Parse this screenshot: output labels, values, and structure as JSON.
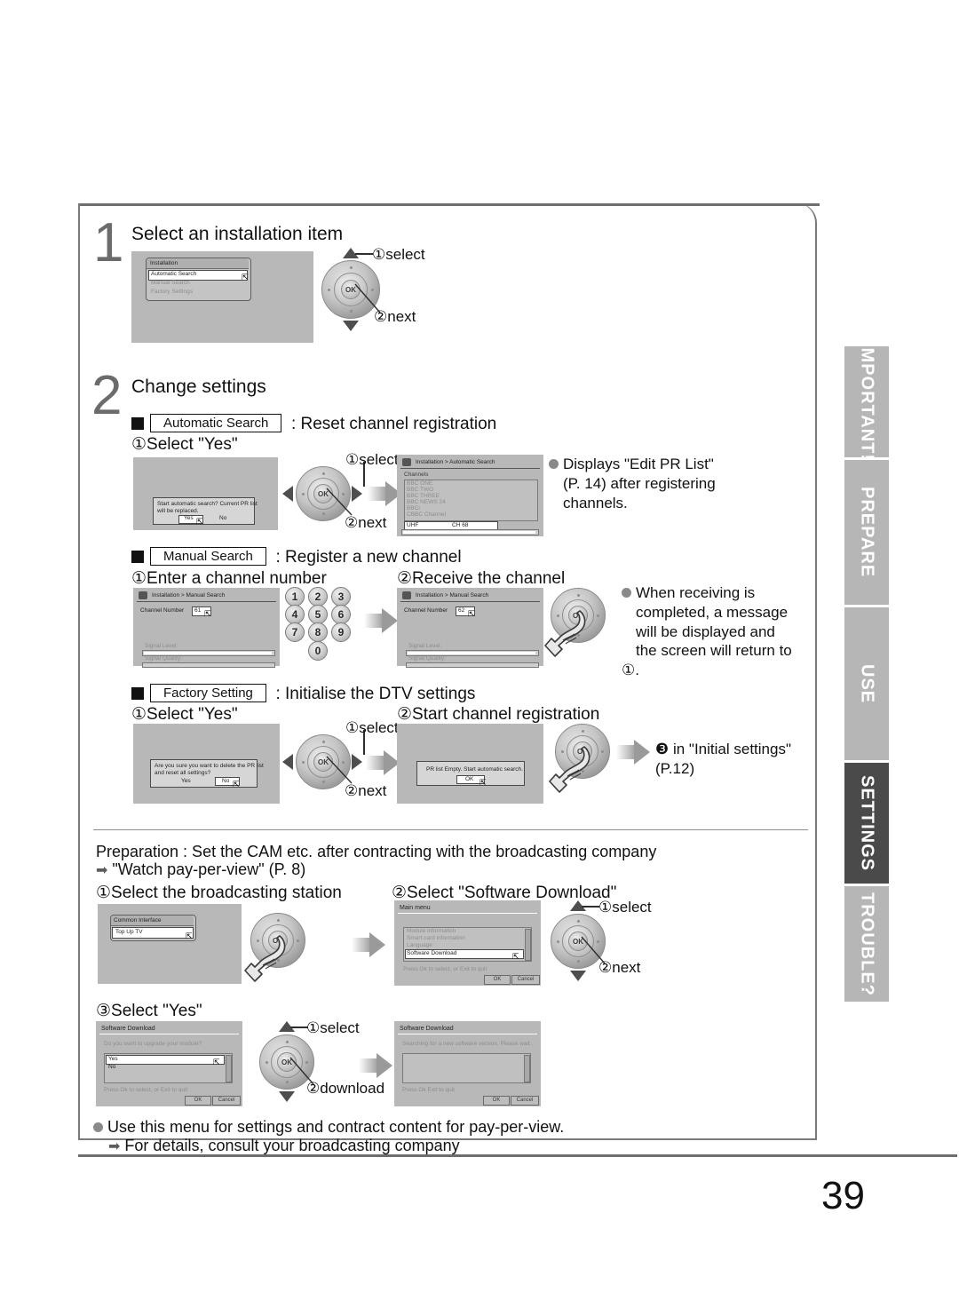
{
  "page": {
    "number": "39"
  },
  "tabs": [
    {
      "label": "IMPORTANT!",
      "active": false
    },
    {
      "label": "PREPARE",
      "active": false
    },
    {
      "label": "USE",
      "active": false
    },
    {
      "label": "SETTINGS",
      "active": true
    },
    {
      "label": "TROUBLE?",
      "active": false
    }
  ],
  "step1": {
    "number": "1",
    "title": "Select an installation item",
    "screen": {
      "menu_title": "Installation",
      "items": [
        "Automatic Search",
        "Manual Search",
        "Factory Settings"
      ],
      "selected": "Automatic Search"
    },
    "ring_labels": {
      "select": "①select",
      "next": "②next"
    }
  },
  "step2": {
    "number": "2",
    "title": "Change settings",
    "auto": {
      "box_label": "Automatic Search",
      "heading_suffix": ": Reset channel registration",
      "substep": "①Select \"Yes\"",
      "dialog": {
        "text_line1": "Start automatic search? Current PR list",
        "text_line2": "will be replaced.",
        "yes": "Yes",
        "no": "No"
      },
      "ring_labels": {
        "select": "①select",
        "next": "②next"
      },
      "result_screen": {
        "title": "Installation > Automatic Search",
        "list_label": "Channels",
        "channels": [
          "BBC ONE",
          "BBC TWO",
          "BBC THREE",
          "BBC NEWS 24",
          "BBCi",
          "CBBC Channel"
        ],
        "band": "UHF",
        "channel": "CH 68",
        "progress": "100%"
      },
      "note_line1": "Displays \"Edit PR List\"",
      "note_line2": "(P. 14) after registering",
      "note_line3": "channels."
    },
    "manual": {
      "box_label": "Manual Search",
      "heading_suffix": ": Register a new channel",
      "substep1": "①Enter a channel number",
      "substep2": "②Receive the channel",
      "screen1": {
        "title": "Installation > Manual Search",
        "field_label": "Channel Number",
        "value": "61",
        "signal_level": "Signal Level:",
        "signal_quality": "Signal Quality:"
      },
      "screen2": {
        "title": "Installation > Manual Search",
        "field_label": "Channel Number",
        "value": "62",
        "signal_level": "Signal Level:",
        "signal_quality": "Signal Quality:"
      },
      "keypad": [
        "1",
        "2",
        "3",
        "4",
        "5",
        "6",
        "7",
        "8",
        "9",
        "0"
      ],
      "note_line1": "When receiving is",
      "note_line2": "completed, a message",
      "note_line3": "will be displayed and",
      "note_line4": "the screen will return to ①."
    },
    "factory": {
      "box_label": "Factory Setting",
      "heading_suffix": ": Initialise the DTV settings",
      "substep1": "①Select \"Yes\"",
      "substep2": "②Start channel registration",
      "dialog": {
        "text_line1": "Are you sure you want to delete the PR list",
        "text_line2": "and reset all settings?",
        "yes": "Yes",
        "no": "No"
      },
      "ring_labels": {
        "select": "①select",
        "next": "②next"
      },
      "screen2": {
        "message": "PR list Empty. Start automatic search.",
        "ok": "OK"
      },
      "note_line1": "❸ in \"Initial settings\"",
      "note_line2": "(P.12)"
    }
  },
  "prep": {
    "line1": "Preparation : Set the CAM etc. after contracting with the broadcasting company",
    "line2": "\"Watch pay-per-view\" (P. 8)",
    "substep1": "①Select the broadcasting station",
    "substep2": "②Select \"Software Download\"",
    "substep3": "③Select \"Yes\"",
    "ci_screen": {
      "menu_title": "Common Interface",
      "item": "Top Up TV"
    },
    "main_menu": {
      "title": "Main menu",
      "items": [
        "Module information",
        "Smart card information",
        "Language",
        "Software Download"
      ],
      "selected": "Software Download",
      "hint": "Press Ok to select, or Exit to quit",
      "ok": "OK",
      "cancel": "Cancel"
    },
    "ring_labels": {
      "select": "①select",
      "next": "②next"
    },
    "dl_screen1": {
      "title": "Software Download",
      "question": "Do you want to upgrade your module?",
      "options": [
        "Yes",
        "No"
      ],
      "selected": "Yes",
      "hint": "Press Ok to select, or Exit to quit",
      "ok": "OK",
      "cancel": "Cancel"
    },
    "dl_ring_labels": {
      "select": "①select",
      "download": "②download"
    },
    "dl_screen2": {
      "title": "Software Download",
      "message": "Searching for a new software version. Please wait .",
      "hint": "Press Ok Exit to quit",
      "ok": "OK",
      "cancel": "Cancel"
    },
    "footer_line1": "Use this menu for settings and contract content for pay-per-view.",
    "footer_line2": "For details, consult your broadcasting company"
  }
}
